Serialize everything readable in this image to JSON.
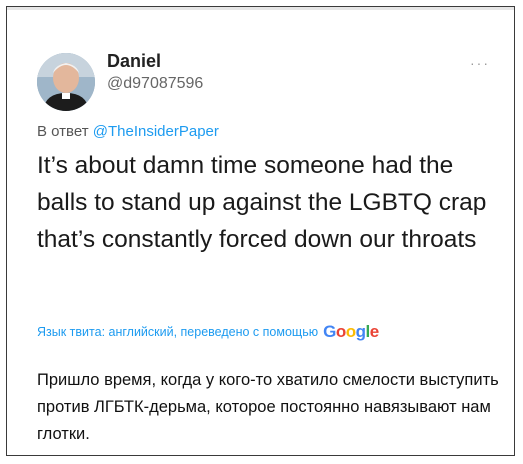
{
  "tweet": {
    "author_name": "Daniel",
    "author_handle": "@d97087596",
    "reply_prefix": "В ответ",
    "reply_mention": "@TheInsiderPaper",
    "more_icon": "more-horizontal-icon",
    "text": "It’s about damn time someone had the balls to stand up against the LGBTQ crap that’s constantly forced down our throats"
  },
  "translation": {
    "note": "Язык твита: английский, переведено с помощью",
    "provider": "Google",
    "text": "Пришло время, когда у кого-то хватило смелости выступить против ЛГБТК-дерьма, которое постоянно навязывают нам глотки."
  },
  "colors": {
    "link": "#1d9bf0",
    "google_blue": "#4285F4",
    "google_red": "#EA4335",
    "google_yellow": "#FBBC05",
    "google_green": "#34A853"
  }
}
